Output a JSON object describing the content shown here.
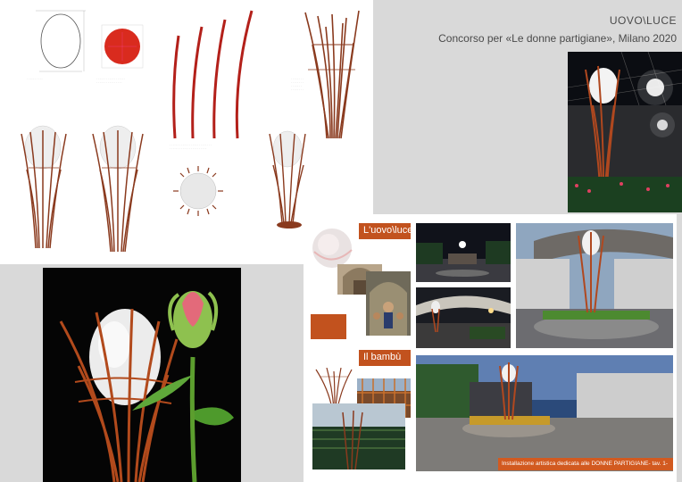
{
  "header": {
    "title": "UOVO\\LUCE",
    "subtitle": "Concorso per «Le donne partigiane», Milano 2020"
  },
  "sheet_bottom": {
    "label_uovo": "L'uovo\\luce",
    "label_bambu": "Il bambù",
    "caption": "Installazione artistica dedicata alle DONNE PARTIGIANE- tav. 1-"
  },
  "colors": {
    "accent": "#c2521e",
    "rust": "#8a3a1e",
    "egg": "#f2f2f2",
    "title_text": "#4a4a4a"
  }
}
